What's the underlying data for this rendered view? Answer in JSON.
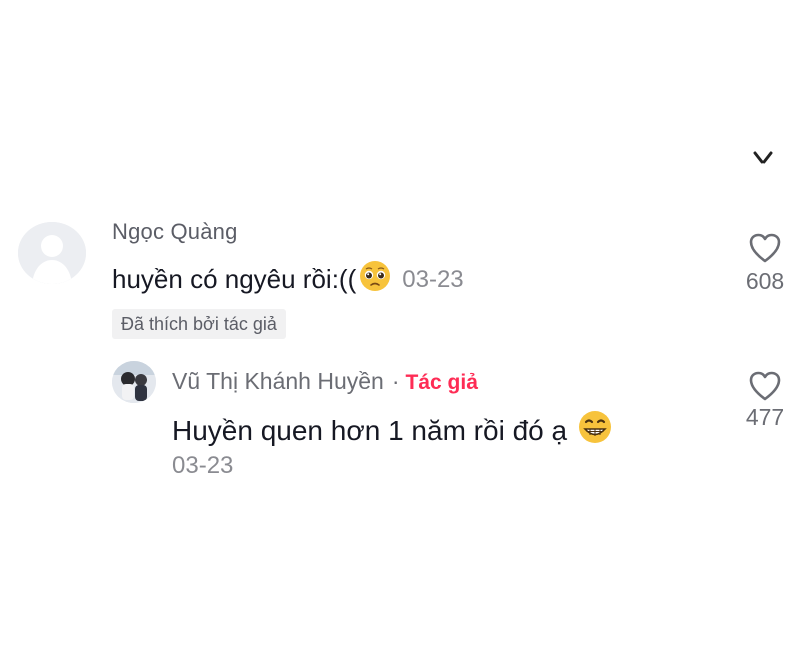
{
  "comments": [
    {
      "username": "Ngọc Quàng",
      "text": "huyền có ngyêu rồi:((",
      "emoji": "pleading-face",
      "date": "03-23",
      "liked_by_author_label": "Đã thích bởi tác giả",
      "like_count": "608"
    }
  ],
  "reply": {
    "username": "Vũ Thị Khánh Huyền",
    "separator": "·",
    "author_tag": "Tác giả",
    "text": "Huyền quen hơn 1 năm rồi đó ạ",
    "emoji": "grinning-face",
    "date": "03-23",
    "like_count": "477"
  },
  "colors": {
    "author_tag": "#fe2c55",
    "primary_text": "#161823",
    "secondary_text": "#8a8b91",
    "badge_bg": "#f1f1f2",
    "emoji_yellow": "#f7c33c"
  },
  "icons": [
    "close-icon",
    "heart-outline-icon",
    "pleading-face-emoji",
    "grinning-face-emoji",
    "default-avatar-icon"
  ]
}
